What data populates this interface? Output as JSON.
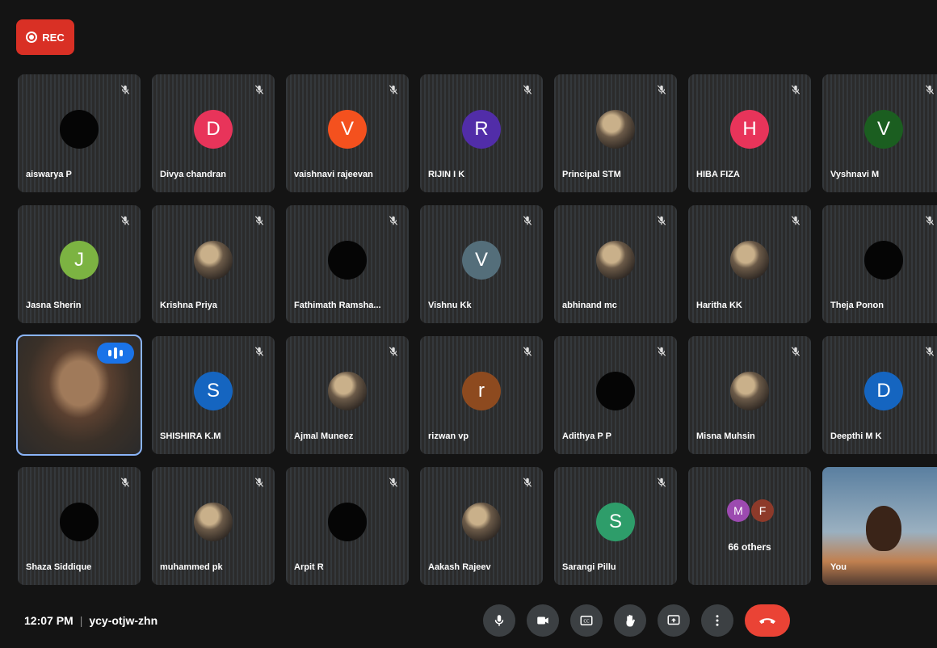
{
  "recording": {
    "label": "REC",
    "color": "#d93025"
  },
  "participants": [
    {
      "name": "aiswarya P",
      "initial": "",
      "avatar": "blank",
      "color": ""
    },
    {
      "name": "Divya chandran",
      "initial": "D",
      "avatar": "letter",
      "color": "#e8345a"
    },
    {
      "name": "vaishnavi rajeevan",
      "initial": "V",
      "avatar": "letter",
      "color": "#f4511e"
    },
    {
      "name": "RIJIN I K",
      "initial": "R",
      "avatar": "letter",
      "color": "#512da8"
    },
    {
      "name": "Principal STM",
      "initial": "",
      "avatar": "photo",
      "color": ""
    },
    {
      "name": "HIBA FIZA",
      "initial": "H",
      "avatar": "letter",
      "color": "#e8345a"
    },
    {
      "name": "Vyshnavi M",
      "initial": "V",
      "avatar": "letter",
      "color": "#1b5e20"
    },
    {
      "name": "Jasna Sherin",
      "initial": "J",
      "avatar": "letter",
      "color": "#7cb342"
    },
    {
      "name": "Krishna Priya",
      "initial": "",
      "avatar": "photo",
      "color": ""
    },
    {
      "name": "Fathimath Ramsha...",
      "initial": "",
      "avatar": "blank",
      "color": ""
    },
    {
      "name": "Vishnu Kk",
      "initial": "V",
      "avatar": "letter",
      "color": "#546e7a"
    },
    {
      "name": "abhinand mc",
      "initial": "",
      "avatar": "photo",
      "color": ""
    },
    {
      "name": "Haritha KK",
      "initial": "",
      "avatar": "photo",
      "color": ""
    },
    {
      "name": "Theja Ponon",
      "initial": "",
      "avatar": "blank",
      "color": ""
    },
    {
      "name": "",
      "initial": "",
      "avatar": "video",
      "color": "",
      "speaking": true
    },
    {
      "name": "SHISHIRA K.M",
      "initial": "S",
      "avatar": "letter",
      "color": "#1565c0"
    },
    {
      "name": "Ajmal Muneez",
      "initial": "",
      "avatar": "photo",
      "color": ""
    },
    {
      "name": "rizwan vp",
      "initial": "r",
      "avatar": "letter",
      "color": "#8d4a1f"
    },
    {
      "name": "Adithya P P",
      "initial": "",
      "avatar": "blank",
      "color": ""
    },
    {
      "name": "Misna Muhsin",
      "initial": "",
      "avatar": "photo",
      "color": ""
    },
    {
      "name": "Deepthi M K",
      "initial": "D",
      "avatar": "letter",
      "color": "#1565c0"
    },
    {
      "name": "Shaza Siddique",
      "initial": "",
      "avatar": "blank",
      "color": ""
    },
    {
      "name": "muhammed pk",
      "initial": "",
      "avatar": "photo",
      "color": ""
    },
    {
      "name": "Arpit R",
      "initial": "",
      "avatar": "blank",
      "color": ""
    },
    {
      "name": "Aakash Rajeev",
      "initial": "",
      "avatar": "photo",
      "color": ""
    },
    {
      "name": "Sarangi Pillu",
      "initial": "S",
      "avatar": "letter",
      "color": "#2e9d6a"
    },
    {
      "name": "66 others",
      "initial": "",
      "avatar": "others",
      "color": "",
      "others": [
        {
          "initial": "M",
          "color": "#9c4ab0"
        },
        {
          "initial": "F",
          "color": "#8d3a2a"
        }
      ]
    },
    {
      "name": "You",
      "initial": "",
      "avatar": "self",
      "color": ""
    }
  ],
  "footer": {
    "time": "12:07 PM",
    "meeting_code": "ycy-otjw-zhn"
  },
  "controls": [
    {
      "id": "mic",
      "icon": "microphone-icon"
    },
    {
      "id": "camera",
      "icon": "camera-icon"
    },
    {
      "id": "captions",
      "icon": "captions-icon"
    },
    {
      "id": "raise-hand",
      "icon": "hand-icon"
    },
    {
      "id": "present",
      "icon": "present-screen-icon"
    },
    {
      "id": "more",
      "icon": "more-options-icon"
    },
    {
      "id": "end-call",
      "icon": "end-call-icon"
    }
  ]
}
